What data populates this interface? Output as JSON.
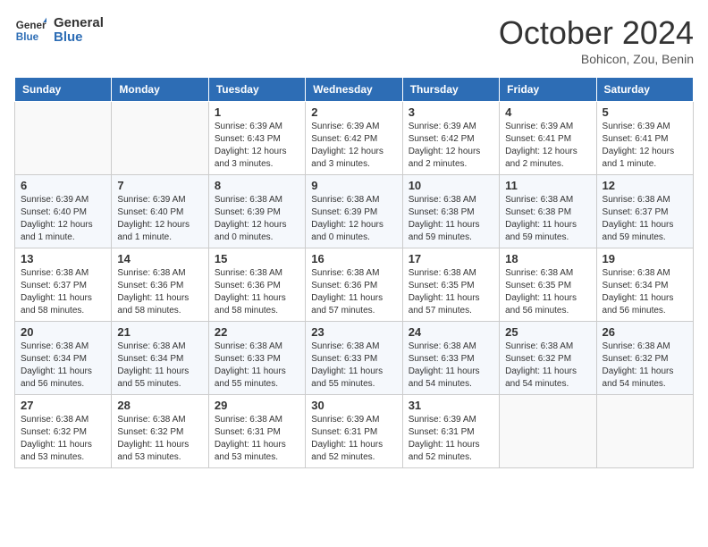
{
  "header": {
    "logo_general": "General",
    "logo_blue": "Blue",
    "month": "October 2024",
    "location": "Bohicon, Zou, Benin"
  },
  "columns": [
    "Sunday",
    "Monday",
    "Tuesday",
    "Wednesday",
    "Thursday",
    "Friday",
    "Saturday"
  ],
  "weeks": [
    [
      {
        "day": "",
        "info": ""
      },
      {
        "day": "",
        "info": ""
      },
      {
        "day": "1",
        "info": "Sunrise: 6:39 AM\nSunset: 6:43 PM\nDaylight: 12 hours and 3 minutes."
      },
      {
        "day": "2",
        "info": "Sunrise: 6:39 AM\nSunset: 6:42 PM\nDaylight: 12 hours and 3 minutes."
      },
      {
        "day": "3",
        "info": "Sunrise: 6:39 AM\nSunset: 6:42 PM\nDaylight: 12 hours and 2 minutes."
      },
      {
        "day": "4",
        "info": "Sunrise: 6:39 AM\nSunset: 6:41 PM\nDaylight: 12 hours and 2 minutes."
      },
      {
        "day": "5",
        "info": "Sunrise: 6:39 AM\nSunset: 6:41 PM\nDaylight: 12 hours and 1 minute."
      }
    ],
    [
      {
        "day": "6",
        "info": "Sunrise: 6:39 AM\nSunset: 6:40 PM\nDaylight: 12 hours and 1 minute."
      },
      {
        "day": "7",
        "info": "Sunrise: 6:39 AM\nSunset: 6:40 PM\nDaylight: 12 hours and 1 minute."
      },
      {
        "day": "8",
        "info": "Sunrise: 6:38 AM\nSunset: 6:39 PM\nDaylight: 12 hours and 0 minutes."
      },
      {
        "day": "9",
        "info": "Sunrise: 6:38 AM\nSunset: 6:39 PM\nDaylight: 12 hours and 0 minutes."
      },
      {
        "day": "10",
        "info": "Sunrise: 6:38 AM\nSunset: 6:38 PM\nDaylight: 11 hours and 59 minutes."
      },
      {
        "day": "11",
        "info": "Sunrise: 6:38 AM\nSunset: 6:38 PM\nDaylight: 11 hours and 59 minutes."
      },
      {
        "day": "12",
        "info": "Sunrise: 6:38 AM\nSunset: 6:37 PM\nDaylight: 11 hours and 59 minutes."
      }
    ],
    [
      {
        "day": "13",
        "info": "Sunrise: 6:38 AM\nSunset: 6:37 PM\nDaylight: 11 hours and 58 minutes."
      },
      {
        "day": "14",
        "info": "Sunrise: 6:38 AM\nSunset: 6:36 PM\nDaylight: 11 hours and 58 minutes."
      },
      {
        "day": "15",
        "info": "Sunrise: 6:38 AM\nSunset: 6:36 PM\nDaylight: 11 hours and 58 minutes."
      },
      {
        "day": "16",
        "info": "Sunrise: 6:38 AM\nSunset: 6:36 PM\nDaylight: 11 hours and 57 minutes."
      },
      {
        "day": "17",
        "info": "Sunrise: 6:38 AM\nSunset: 6:35 PM\nDaylight: 11 hours and 57 minutes."
      },
      {
        "day": "18",
        "info": "Sunrise: 6:38 AM\nSunset: 6:35 PM\nDaylight: 11 hours and 56 minutes."
      },
      {
        "day": "19",
        "info": "Sunrise: 6:38 AM\nSunset: 6:34 PM\nDaylight: 11 hours and 56 minutes."
      }
    ],
    [
      {
        "day": "20",
        "info": "Sunrise: 6:38 AM\nSunset: 6:34 PM\nDaylight: 11 hours and 56 minutes."
      },
      {
        "day": "21",
        "info": "Sunrise: 6:38 AM\nSunset: 6:34 PM\nDaylight: 11 hours and 55 minutes."
      },
      {
        "day": "22",
        "info": "Sunrise: 6:38 AM\nSunset: 6:33 PM\nDaylight: 11 hours and 55 minutes."
      },
      {
        "day": "23",
        "info": "Sunrise: 6:38 AM\nSunset: 6:33 PM\nDaylight: 11 hours and 55 minutes."
      },
      {
        "day": "24",
        "info": "Sunrise: 6:38 AM\nSunset: 6:33 PM\nDaylight: 11 hours and 54 minutes."
      },
      {
        "day": "25",
        "info": "Sunrise: 6:38 AM\nSunset: 6:32 PM\nDaylight: 11 hours and 54 minutes."
      },
      {
        "day": "26",
        "info": "Sunrise: 6:38 AM\nSunset: 6:32 PM\nDaylight: 11 hours and 54 minutes."
      }
    ],
    [
      {
        "day": "27",
        "info": "Sunrise: 6:38 AM\nSunset: 6:32 PM\nDaylight: 11 hours and 53 minutes."
      },
      {
        "day": "28",
        "info": "Sunrise: 6:38 AM\nSunset: 6:32 PM\nDaylight: 11 hours and 53 minutes."
      },
      {
        "day": "29",
        "info": "Sunrise: 6:38 AM\nSunset: 6:31 PM\nDaylight: 11 hours and 53 minutes."
      },
      {
        "day": "30",
        "info": "Sunrise: 6:39 AM\nSunset: 6:31 PM\nDaylight: 11 hours and 52 minutes."
      },
      {
        "day": "31",
        "info": "Sunrise: 6:39 AM\nSunset: 6:31 PM\nDaylight: 11 hours and 52 minutes."
      },
      {
        "day": "",
        "info": ""
      },
      {
        "day": "",
        "info": ""
      }
    ]
  ]
}
